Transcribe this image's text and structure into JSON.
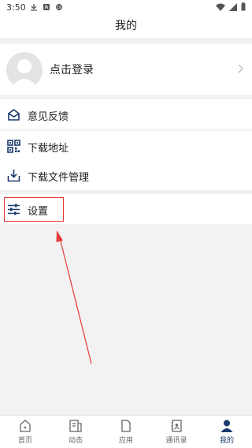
{
  "status_bar": {
    "time": "3:50"
  },
  "header": {
    "title": "我的"
  },
  "profile": {
    "login_label": "点击登录"
  },
  "menu": {
    "feedback": "意见反馈",
    "download_address": "下载地址",
    "download_manager": "下载文件管理",
    "settings": "设置"
  },
  "tabs": [
    {
      "label": "首页",
      "icon": "home-icon",
      "active": false
    },
    {
      "label": "动态",
      "icon": "news-icon",
      "active": false
    },
    {
      "label": "应用",
      "icon": "document-icon",
      "active": false
    },
    {
      "label": "通讯录",
      "icon": "contacts-icon",
      "active": false
    },
    {
      "label": "我的",
      "icon": "person-icon",
      "active": true
    }
  ],
  "colors": {
    "accent": "#1a3a6b",
    "highlight": "#e53935"
  }
}
